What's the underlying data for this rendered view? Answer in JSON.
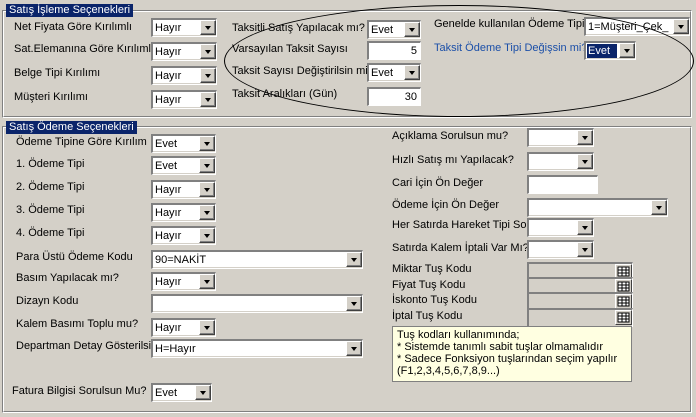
{
  "top_section": {
    "title": "Satış İşleme Seçenekleri",
    "net_fiyata": {
      "label": "Net Fiyata Göre Kırılımlı",
      "value": "Hayır"
    },
    "sat_elemanina": {
      "label": "Sat.Elemanına Göre Kırılımlı",
      "value": "Hayır"
    },
    "belge_tipi": {
      "label": "Belge Tipi Kırılımı",
      "value": "Hayır"
    },
    "musteri": {
      "label": "Müşteri Kırılımı",
      "value": "Hayır"
    },
    "taksitli_satis": {
      "label": "Taksitli Satış Yapılacak mı?",
      "value": "Evet"
    },
    "varsayilan_taksit": {
      "label": "Varsayılan Taksit Sayısı",
      "value": "5"
    },
    "taksit_degistir": {
      "label": "Taksit Sayısı Değiştirilsin mi?",
      "value": "Evet"
    },
    "taksit_aralik": {
      "label": "Taksit Aralıkları (Gün)",
      "value": "30"
    },
    "genelde_odeme": {
      "label": "Genelde kullanılan Ödeme Tipi",
      "value": "1=Müşteri_Çek_"
    },
    "taksit_odeme_degis": {
      "label": "Taksit Ödeme Tipi Değişsin mi?",
      "value": "Evet"
    }
  },
  "bottom_section": {
    "title": "Satış Ödeme Seçenekleri",
    "odeme_tipine": {
      "label": "Ödeme Tipine Göre Kırılım",
      "value": "Evet"
    },
    "odeme1": {
      "label": "1. Ödeme Tipi",
      "value": "Evet"
    },
    "odeme2": {
      "label": "2. Ödeme Tipi",
      "value": "Hayır"
    },
    "odeme3": {
      "label": "3. Ödeme Tipi",
      "value": "Hayır"
    },
    "odeme4": {
      "label": "4. Ödeme Tipi",
      "value": "Hayır"
    },
    "para_ustu": {
      "label": "Para Üstü Ödeme Kodu",
      "value": "90=NAKİT"
    },
    "basim": {
      "label": "Basım Yapılacak mı?",
      "value": "Hayır"
    },
    "dizayn": {
      "label": "Dizayn Kodu",
      "value": ""
    },
    "kalem_basimi": {
      "label": "Kalem Basımı Toplu mu?",
      "value": "Hayır"
    },
    "departman": {
      "label": "Departman Detay Gösterilsin",
      "value": "H=Hayır"
    },
    "fatura_bilgisi": {
      "label": "Fatura Bilgisi Sorulsun Mu?",
      "value": "Evet"
    },
    "aciklama": {
      "label": "Açıklama Sorulsun mu?",
      "value": ""
    },
    "hizli_satis": {
      "label": "Hızlı Satış mı Yapılacak?",
      "value": ""
    },
    "cari_deger": {
      "label": "Cari İçin Ön Değer",
      "value": ""
    },
    "odeme_deger": {
      "label": "Ödeme İçin Ön Değer",
      "value": ""
    },
    "hareket_tipi": {
      "label": "Her Satırda Hareket Tipi Sor",
      "value": ""
    },
    "kalem_iptal": {
      "label": "Satırda Kalem İptali Var Mı?",
      "value": ""
    },
    "miktar_tus": {
      "label": "Miktar Tuş Kodu",
      "value": ""
    },
    "fiyat_tus": {
      "label": "Fiyat Tuş Kodu",
      "value": ""
    },
    "iskonto_tus": {
      "label": "İskonto Tuş Kodu",
      "value": ""
    },
    "iptal_tus": {
      "label": "İptal Tuş Kodu",
      "value": ""
    },
    "note": {
      "line1": "Tuş kodları kullanımında;",
      "line2": "* Sistemde tanımlı sabit tuşlar olmamalıdır",
      "line3": "* Sadece Fonksiyon tuşlarından seçim yapılır",
      "line4": "(F1,2,3,4,5,6,7,8,9...)"
    }
  }
}
